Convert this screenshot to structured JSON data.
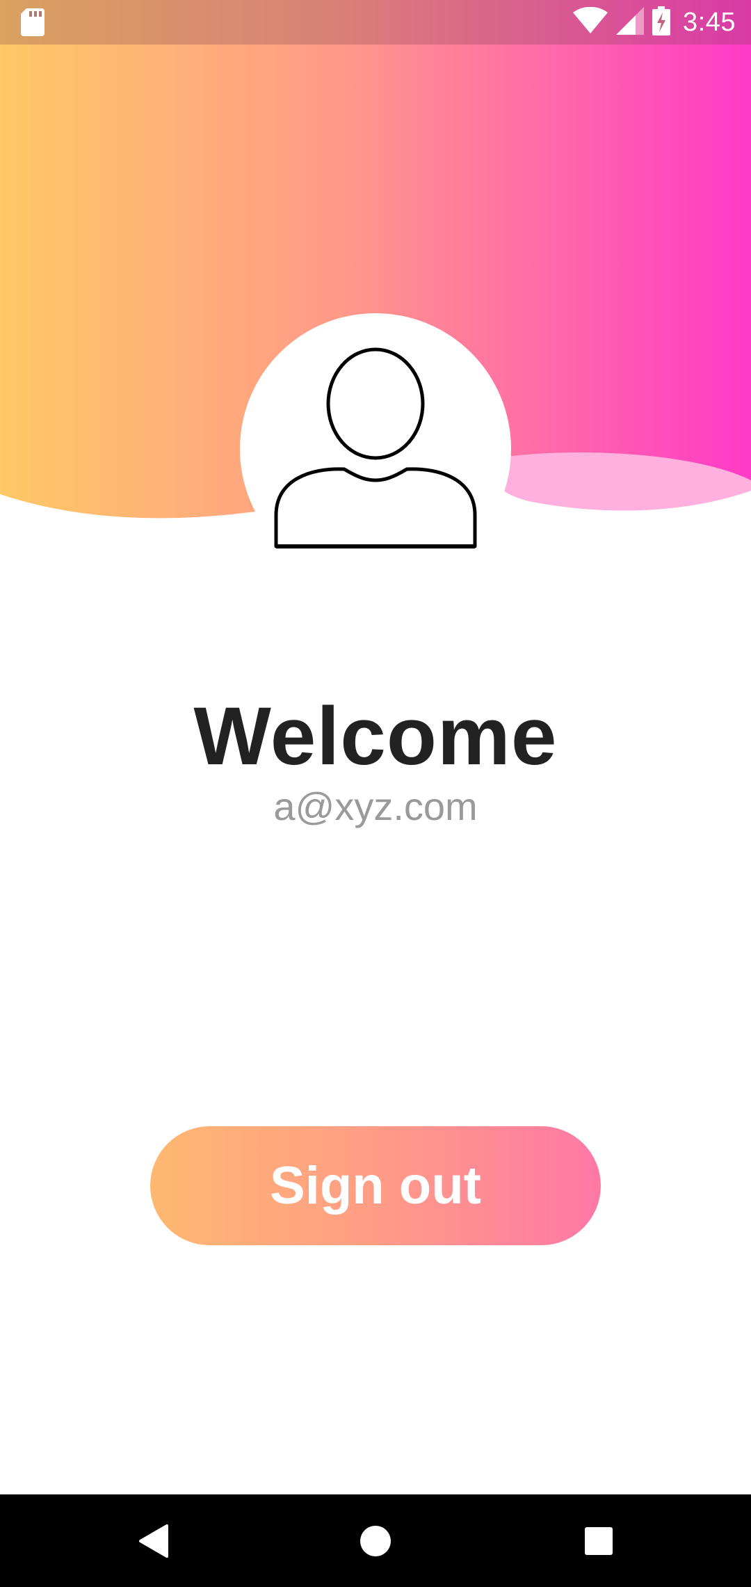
{
  "status_bar": {
    "time": "3:45",
    "icons": [
      "sd-card-icon",
      "wifi-icon",
      "cell-signal-icon",
      "battery-charging-icon"
    ]
  },
  "profile": {
    "avatar_icon": "person-icon",
    "title": "Welcome",
    "email": "a@xyz.com"
  },
  "actions": {
    "sign_out_label": "Sign out"
  },
  "nav": {
    "icons": [
      "back-icon",
      "home-icon",
      "recents-icon"
    ]
  },
  "colors": {
    "gradient_start": "#ffc966",
    "gradient_mid": "#ff8c95",
    "gradient_end": "#ff3ac8",
    "title": "#222222",
    "email": "#9a9a9a",
    "button_start": "#ffb870",
    "button_end": "#ff78a6"
  }
}
